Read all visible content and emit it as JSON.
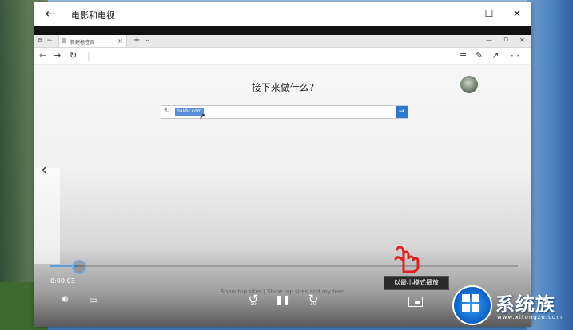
{
  "window": {
    "title": "电影和电视",
    "back": "←",
    "minimize": "—",
    "maximize": "☐",
    "close": "✕"
  },
  "browser": {
    "tab_label": "新建标签页",
    "new_tab": "+",
    "tab_menu": "⌄",
    "win_minimize": "—",
    "win_restore": "▫",
    "win_close": "✕",
    "heading": "接下来做什么?",
    "search_value": "baidu.com",
    "show_sites": "Show top sites | Show top sites and my feed"
  },
  "player": {
    "time": "0:00:03",
    "progress": 0.06,
    "skip_back": "10",
    "skip_forward": "30",
    "tooltip": "以最小模式播放"
  },
  "watermark": {
    "name": "系统族",
    "url": "www.xitongzu.com"
  },
  "colors": {
    "accent": "#2b79d0",
    "progress": "#5aa0e0",
    "hand": "#e02020"
  }
}
